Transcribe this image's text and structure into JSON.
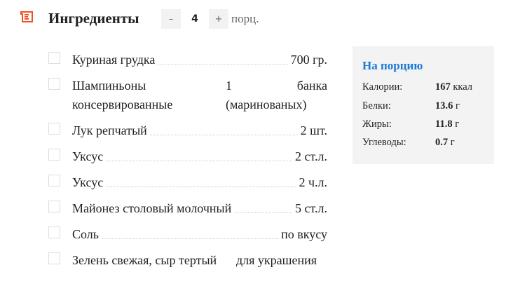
{
  "header": {
    "title": "Ингредиенты",
    "minus": "–",
    "servings": "4",
    "plus": "+",
    "unit": "порц.",
    "accent": "#f2501e"
  },
  "ingredients": [
    {
      "name": "Куриная грудка",
      "amount": "700 гр."
    },
    {
      "name": "Шампиньоны консервированные",
      "amount": "1 банка (маринованых)"
    },
    {
      "name": "Лук репчатый",
      "amount": "2 шт."
    },
    {
      "name": "Уксус",
      "amount": "2 ст.л."
    },
    {
      "name": "Уксус",
      "amount": "2 ч.л."
    },
    {
      "name": "Майонез столовый молочный",
      "amount": "5 ст.л."
    },
    {
      "name": "Соль",
      "amount": "по вкусу"
    },
    {
      "name": "Зелень свежая, сыр тертый",
      "amount": "для украшения"
    }
  ],
  "nutrition": {
    "title": "На порцию",
    "items": [
      {
        "label": "Калории:",
        "value": "167",
        "unit": "ккал"
      },
      {
        "label": "Белки:",
        "value": "13.6",
        "unit": "г"
      },
      {
        "label": "Жиры:",
        "value": "11.8",
        "unit": "г"
      },
      {
        "label": "Углеводы:",
        "value": "0.7",
        "unit": "г"
      }
    ]
  }
}
